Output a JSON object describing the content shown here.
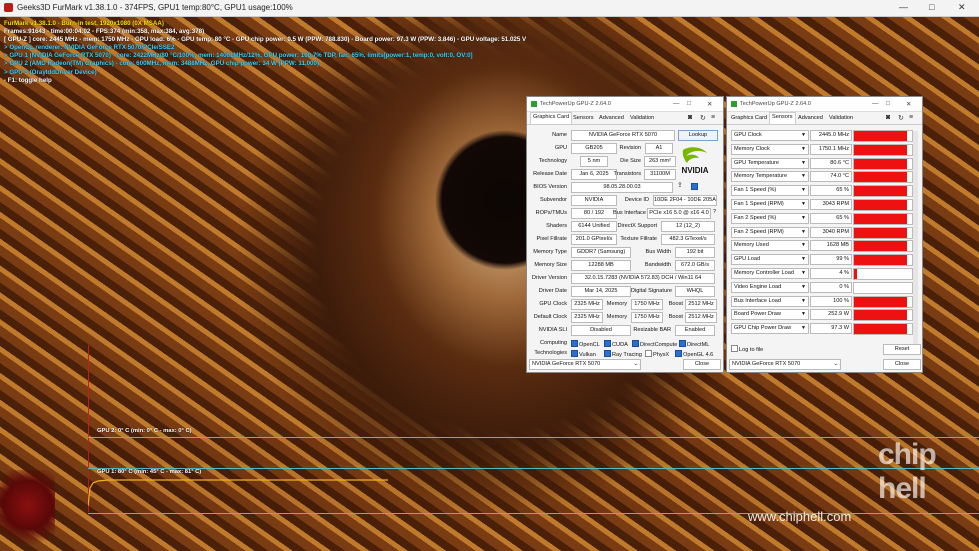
{
  "window": {
    "title": "Geeks3D FurMark v1.38.1.0 - 374FPS, GPU1 temp:80°C, GPU1 usage:100%",
    "controls": [
      "—",
      "□",
      "✕"
    ]
  },
  "hud": {
    "lines": [
      {
        "text": "FurMark v1.38.1.0 - Burn-in test, 1920x1080 (0X MSAA)",
        "color": "yellow"
      },
      {
        "text": "Frames:91643 - time:00:04:02 - FPS:374 (min:358, max:384, avg:378)",
        "color": "white"
      },
      {
        "text": "[ GPU-Z ] core: 2445 MHz - mem: 1750 MHz - GPU load: 6% - GPU temp: 80 °C - GPU chip power: 0.5 W (PPW: 788.830) - Board power: 97.3 W (PPW: 3.846) - GPU voltage: 51.025 V",
        "color": "white"
      },
      {
        "text": "> OpenGL renderer: NVIDIA GeForce RTX 5070/PCIe/SSE2",
        "color": "cyan"
      },
      {
        "text": "> GPU 1 (NVIDIA GeForce RTX 5070) - core: 2422MHz/80 °C/100%, mem: 14001MHz/12%, GPU power: 100.7% TDP, fan: 65%, limits[power:1, temp:0, volt:0, OV:0]",
        "color": "cyan"
      },
      {
        "text": "> GPU 2 (AMD Radeon(TM) Graphics) - core: 600MHz, mem: 3488MHz, GPU chip power: 34 W (PPW: 11.000)",
        "color": "cyan"
      },
      {
        "text": "> GPU 3 (OrayIddDriver Device)",
        "color": "cyan"
      },
      {
        "text": "- F1: toggle help",
        "color": "white"
      }
    ]
  },
  "graphs": {
    "gpu2_label": "GPU 2: 0° C (min: 0° C - max: 0° C)",
    "gpu1_label": "GPU 1: 80° C (min: 45° C - max: 81° C)",
    "gpu1_line_color": "#f0b020",
    "frame_color": "#52b8c8"
  },
  "watermark": {
    "url": "www.chiphell.com",
    "logo_top": "chip",
    "logo_bottom": "hell"
  },
  "gpuz_card": {
    "title": "TechPowerUp GPU-Z 2.64.0",
    "tabs": [
      "Graphics Card",
      "Sensors",
      "Advanced",
      "Validation"
    ],
    "selected_tab": "Graphics Card",
    "lookup": "Lookup",
    "vendor_logo": "NVIDIA",
    "fields": {
      "name_label": "Name",
      "name": "NVIDIA GeForce RTX 5070",
      "gpu_label": "GPU",
      "gpu": "GB205",
      "revision_label": "Revision",
      "revision": "A1",
      "tech_label": "Technology",
      "tech": "5 nm",
      "die_label": "Die Size",
      "die": "263 mm²",
      "release_label": "Release Date",
      "release": "Jan 6, 2025",
      "transistors_label": "Transistors",
      "transistors": "31100M",
      "bios_label": "BIOS Version",
      "bios": "98.05.28.00.03",
      "uefi": "UEFI",
      "subvendor_label": "Subvendor",
      "subvendor": "NVIDIA",
      "deviceid_label": "Device ID",
      "deviceid": "10DE 2F04 - 10DE 205A",
      "rops_label": "ROPs/TMUs",
      "rops": "80 / 192",
      "bus_label": "Bus Interface",
      "bus": "PCIe x16 5.0 @ x16 4.0",
      "shaders_label": "Shaders",
      "shaders": "6144 Unified",
      "dx_label": "DirectX Support",
      "dx": "12 (12_2)",
      "pixel_label": "Pixel Fillrate",
      "pixel": "201.0 GPixel/s",
      "texture_label": "Texture Fillrate",
      "texture": "482.3 GTexel/s",
      "memtype_label": "Memory Type",
      "memtype": "GDDR7 (Samsung)",
      "buswidth_label": "Bus Width",
      "buswidth": "192 bit",
      "memsize_label": "Memory Size",
      "memsize": "12288 MB",
      "bandwidth_label": "Bandwidth",
      "bandwidth": "672.0 GB/s",
      "driver_label": "Driver Version",
      "driver": "32.0.15.7283 (NVIDIA 572.83) DCH / Win11 64",
      "driverdate_label": "Driver Date",
      "driverdate": "Mar 14, 2025",
      "sig_label": "Digital Signature",
      "sig": "WHQL",
      "gpuclock_label": "GPU Clock",
      "gpuclock": "2325 MHz",
      "mem_label": "Memory",
      "memclock": "1750 MHz",
      "boost_label": "Boost",
      "boost": "2512 MHz",
      "defclock_label": "Default Clock",
      "defclock": "2325 MHz",
      "defmem": "1750 MHz",
      "defboost": "2512 MHz",
      "sli_label": "NVIDIA SLI",
      "sli": "Disabled",
      "rebar_label": "Resizable BAR",
      "rebar": "Enabled"
    },
    "computing_label": "Computing",
    "computing": [
      "OpenCL",
      "CUDA",
      "DirectCompute",
      "DirectML"
    ],
    "technologies_label": "Technologies",
    "technologies": [
      "Vulkan",
      "Ray Tracing",
      "PhysX",
      "OpenGL 4.6"
    ],
    "footer_select": "NVIDIA GeForce RTX 5070",
    "close": "Close"
  },
  "gpuz_sensors": {
    "title": "TechPowerUp GPU-Z 2.64.0",
    "tabs": [
      "Graphics Card",
      "Sensors",
      "Advanced",
      "Validation"
    ],
    "selected_tab": "Sensors",
    "rows": [
      {
        "name": "GPU Clock",
        "value": "2445.0 MHz",
        "level": 0.92
      },
      {
        "name": "Memory Clock",
        "value": "1750.1 MHz",
        "level": 0.92
      },
      {
        "name": "GPU Temperature",
        "value": "80.6 °C",
        "level": 0.92
      },
      {
        "name": "Memory Temperature",
        "value": "74.0 °C",
        "level": 0.92
      },
      {
        "name": "Fan 1 Speed (%)",
        "value": "65 %",
        "level": 0.92
      },
      {
        "name": "Fan 1 Speed (RPM)",
        "value": "3043 RPM",
        "level": 0.92
      },
      {
        "name": "Fan 2 Speed (%)",
        "value": "65 %",
        "level": 0.92
      },
      {
        "name": "Fan 2 Speed (RPM)",
        "value": "3040 RPM",
        "level": 0.92
      },
      {
        "name": "Memory Used",
        "value": "1628 MB",
        "level": 0.92
      },
      {
        "name": "GPU Load",
        "value": "99 %",
        "level": 0.92
      },
      {
        "name": "Memory Controller Load",
        "value": "4 %",
        "level": 0.05
      },
      {
        "name": "Video Engine Load",
        "value": "0 %",
        "level": 0.0
      },
      {
        "name": "Bus Interface Load",
        "value": "100 %",
        "level": 0.92
      },
      {
        "name": "Board Power Draw",
        "value": "252.9 W",
        "level": 0.92
      },
      {
        "name": "GPU Chip Power Draw",
        "value": "97.3 W",
        "level": 0.92
      }
    ],
    "log_to_file": "Log to file",
    "reset": "Reset",
    "footer_select": "NVIDIA GeForce RTX 5070",
    "close": "Close"
  }
}
